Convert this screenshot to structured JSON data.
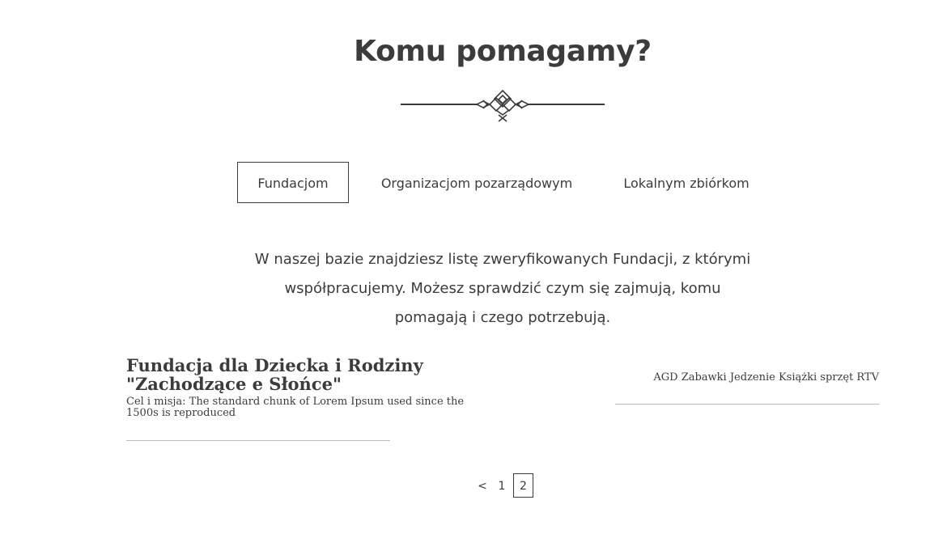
{
  "section": {
    "title": "Komu pomagamy?"
  },
  "tabs": [
    {
      "label": "Fundacjom",
      "active": true
    },
    {
      "label": "Organizacjom pozarządowym",
      "active": false
    },
    {
      "label": "Lokalnym zbiórkom",
      "active": false
    }
  ],
  "intro_text": "W naszej bazie znajdziesz listę zweryfikowanych Fundacji, z którymi współpracujemy. Możesz sprawdzić czym się zajmują, komu pomagają i czego potrzebują.",
  "foundations": [
    {
      "name": "Fundacja dla Dziecka i Rodziny \"Zachodzące e Słońce\"",
      "description": "Cel i misja: The standard chunk of Lorem Ipsum used since the 1500s is reproduced",
      "needs": "AGD Zabawki Jedzenie Książki sprzęt RTV"
    }
  ],
  "pagination": {
    "prev_label": "<",
    "pages": [
      "1",
      "2"
    ],
    "current": "2"
  }
}
